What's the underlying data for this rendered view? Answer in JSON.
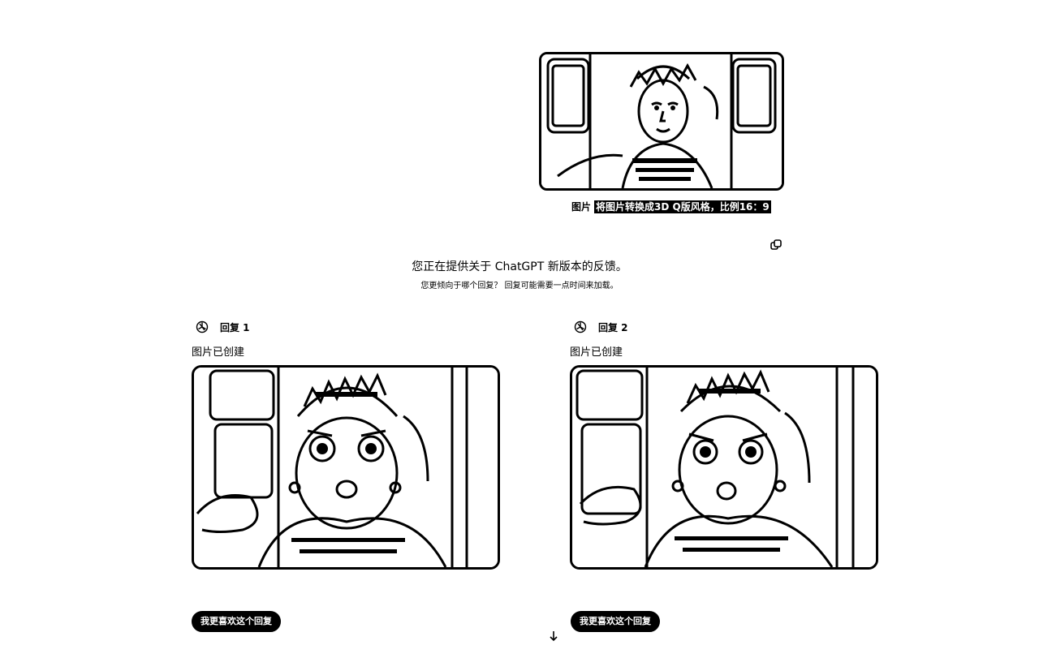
{
  "user_message": {
    "image_label": "图片",
    "prompt": "将图片转换成3D Q版风格，比例16：9"
  },
  "feedback": {
    "title": "您正在提供关于 ChatGPT 新版本的反馈。",
    "subtitle": "您更倾向于哪个回复？ 回复可能需要一点时间来加载。"
  },
  "responses": [
    {
      "label": "回复 1",
      "status": "图片已创建",
      "prefer_label": "我更喜欢这个回复"
    },
    {
      "label": "回复 2",
      "status": "图片已创建",
      "prefer_label": "我更喜欢这个回复"
    }
  ],
  "icons": {
    "copy": "copy-icon",
    "logo": "chatgpt-logo-icon",
    "scroll": "arrow-down-icon"
  }
}
